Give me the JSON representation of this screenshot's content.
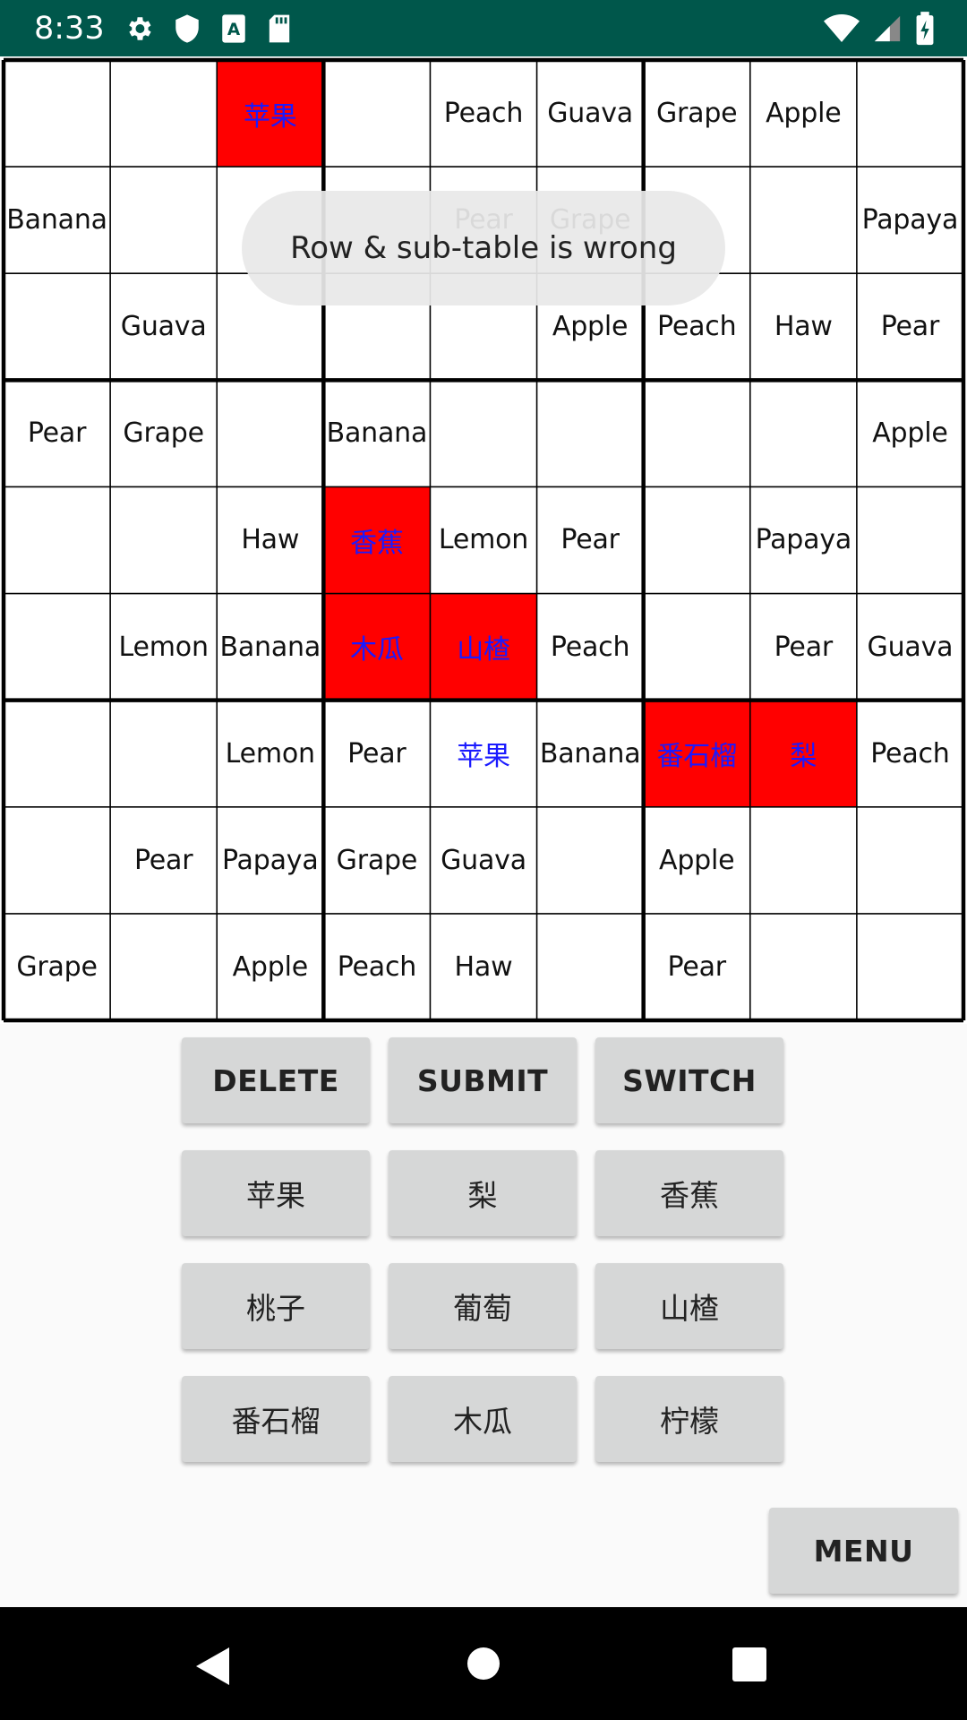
{
  "status_bar": {
    "time": "8:33",
    "left_icons": [
      "settings-icon",
      "shield-icon",
      "sim-a-icon",
      "sd-card-icon"
    ],
    "right_icons": [
      "wifi-icon",
      "signal-icon",
      "battery-icon"
    ]
  },
  "grid": {
    "rows": [
      [
        "",
        "",
        "苹果",
        "",
        "Peach",
        "Guava",
        "Grape",
        "Apple",
        ""
      ],
      [
        "Banana",
        "",
        "",
        "",
        "Pear",
        "Grape",
        "",
        "",
        "Papaya"
      ],
      [
        "",
        "Guava",
        "",
        "",
        "",
        "Apple",
        "Peach",
        "Haw",
        "Pear"
      ],
      [
        "Pear",
        "Grape",
        "",
        "Banana",
        "",
        "",
        "",
        "",
        "Apple"
      ],
      [
        "",
        "",
        "Haw",
        "香蕉",
        "Lemon",
        "Pear",
        "",
        "Papaya",
        ""
      ],
      [
        "",
        "Lemon",
        "Banana",
        "木瓜",
        "山楂",
        "Peach",
        "",
        "Pear",
        "Guava"
      ],
      [
        "",
        "",
        "Lemon",
        "Pear",
        "苹果",
        "Banana",
        "番石榴",
        "梨",
        "Peach"
      ],
      [
        "",
        "Pear",
        "Papaya",
        "Grape",
        "Guava",
        "",
        "Apple",
        "",
        ""
      ],
      [
        "Grape",
        "",
        "Apple",
        "Peach",
        "Haw",
        "",
        "Pear",
        "",
        ""
      ]
    ],
    "user_cells": [
      "0,2",
      "4,3",
      "5,3",
      "5,4",
      "6,4",
      "6,6",
      "6,7"
    ],
    "error_cells": [
      "0,2",
      "4,3",
      "5,3",
      "5,4",
      "6,6",
      "6,7"
    ],
    "error_color": "#ff0000",
    "user_text_color": "#1a1aff"
  },
  "toast": {
    "message": "Row & sub-table is wrong"
  },
  "controls": {
    "delete": "DELETE",
    "submit": "SUBMIT",
    "switch": "SWITCH"
  },
  "fruit_buttons": [
    "苹果",
    "梨",
    "香蕉",
    "桃子",
    "葡萄",
    "山楂",
    "番石榴",
    "木瓜",
    "柠檬"
  ],
  "menu": {
    "label": "MENU"
  },
  "nav_bar": {
    "icons": [
      "back-icon",
      "home-icon",
      "recents-icon"
    ]
  }
}
